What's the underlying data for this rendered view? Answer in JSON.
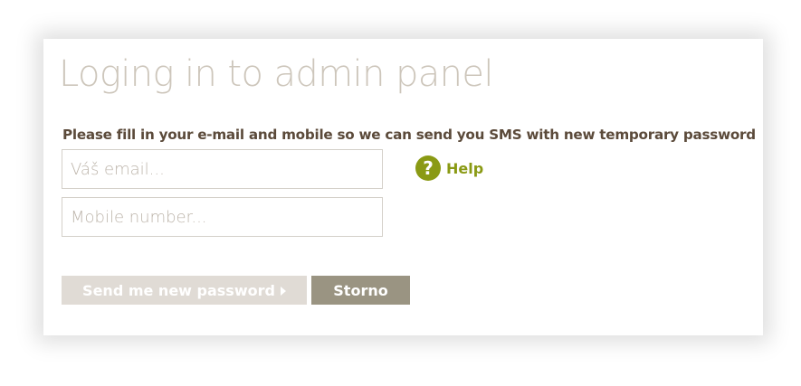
{
  "page": {
    "title": "Loging in to admin panel",
    "instructions": "Please fill in your e-mail and mobile so we can send you SMS with new temporary password"
  },
  "form": {
    "email": {
      "value": "",
      "placeholder": "Váš email..."
    },
    "mobile": {
      "value": "",
      "placeholder": "Mobile number..."
    }
  },
  "help": {
    "icon": "question-circle-icon",
    "glyph": "?",
    "label": "Help",
    "color": "#8a9a14"
  },
  "actions": {
    "send_label": "Send me new password",
    "send_icon": "caret-right-icon",
    "cancel_label": "Storno"
  },
  "colors": {
    "title": "#cdc6bb",
    "instructions": "#5b4a3a",
    "send_button_bg": "#e0dbd5",
    "cancel_button_bg": "#9a9482"
  }
}
